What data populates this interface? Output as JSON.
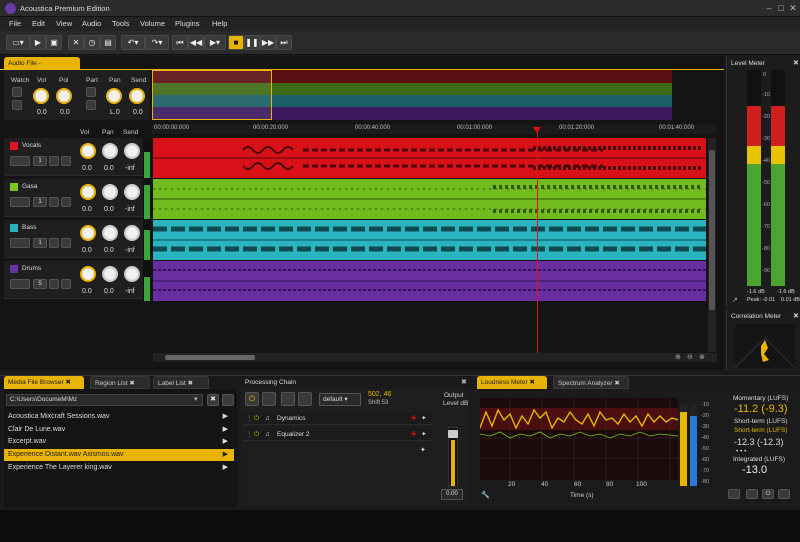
{
  "app": {
    "title": "Acoustica Premium Edition"
  },
  "menu": [
    "File",
    "Edit",
    "View",
    "Audio",
    "Tools",
    "Volume",
    "Plugins",
    "Help"
  ],
  "window_controls": [
    "–",
    "□",
    "✕"
  ],
  "toolbar": {
    "buttons": [
      "new-file-icon",
      "play-icon",
      "save-icon",
      "cut-icon",
      "timer-icon",
      "delete-icon",
      "undo-icon",
      "redo-icon"
    ],
    "transport": [
      "skip-start-icon",
      "rewind-icon",
      "play-icon",
      "stop-icon",
      "pause-icon",
      "fast-forward-icon",
      "skip-end-icon"
    ]
  },
  "editor": {
    "tab_label": "Audio File - Interview.wd",
    "master": {
      "watch_label": "Watch",
      "vol_label": "Vol",
      "pol_label": "Pol",
      "part_label": "Part",
      "pan_label": "Pan",
      "send_label": "Send",
      "vol_value": "0.0",
      "pol_value": "0.0",
      "pan_value": "L.0",
      "send_value": "0.0"
    },
    "track_headers": {
      "vol": "Vol",
      "pan": "Pan",
      "send": "Send"
    },
    "tracks": [
      {
        "name": "Vocals",
        "color": "#e0131a",
        "vol": "0.0",
        "pan": "0.0",
        "send": "-inf",
        "num": "1"
      },
      {
        "name": "Gasa",
        "color": "#7cc620",
        "vol": "0.0",
        "pan": "0.0",
        "send": "-inf",
        "num": "1"
      },
      {
        "name": "Bass",
        "color": "#25b3c2",
        "vol": "0.0",
        "pan": "0.0",
        "send": "-inf",
        "num": "1"
      },
      {
        "name": "Drums",
        "color": "#6b2fa6",
        "vol": "0.0",
        "pan": "0.0",
        "send": "-inf",
        "num": "5"
      }
    ],
    "timeline": [
      "00:00:00:000",
      "00:00:20:000",
      "00:00:40:000",
      "00:01:00:000",
      "00:01:20:000",
      "00:01:40:000"
    ]
  },
  "level_meter": {
    "title": "Level Meter",
    "scale": [
      "0",
      "-10",
      "-20",
      "-30",
      "-40",
      "-50",
      "-60",
      "-70",
      "-80",
      "-90"
    ],
    "left_db": "-1.6 dB",
    "right_db": "-1.6 dB",
    "peak_label": "Peak: -0.01",
    "peak_right": "0.01 dB"
  },
  "correlation": {
    "title": "Correlation Meter"
  },
  "browser": {
    "tabs": [
      "Media File Browser",
      "Region List",
      "Label List"
    ],
    "path": "C:\\Users\\DocumeM\\Mz",
    "files": [
      "Acoustica Mixcraft Sessions.wav",
      "Clair De Lune.wav",
      "Excerpt.wav",
      "Experience  Distant.wav  Axismos.wav",
      "Experience  The Layerer king.wav"
    ],
    "selected_index": 3
  },
  "chain": {
    "title": "Processing Chain",
    "preset": "default",
    "readout_top": "502, 46",
    "readout_bottom": "Shift 53",
    "output_label": "Output",
    "level_label": "Level dB",
    "fader_value": "0.00",
    "effects": [
      "Dynamics",
      "Equalizer 2"
    ]
  },
  "loudness": {
    "tabs": [
      "Loudness Meter",
      "Spectrum Analyzer"
    ],
    "x_ticks": [
      "20",
      "40",
      "60",
      "80",
      "100"
    ],
    "axis_label": "Time (s)",
    "right_scale": [
      "-10",
      "-20",
      "-30",
      "-40",
      "-50",
      "-60",
      "-70",
      "-80"
    ],
    "momentary_label": "Momentary (LUFS)",
    "momentary_value": "-11.2 (-9.3)",
    "shortterm_label": "Short-term (LUFS)",
    "shortterm_value": "Short-term (LUFS)",
    "range_value": "-12.3 (-12.3)",
    "integrated_label": "Integrated (LUFS)",
    "integrated_value": "-13.0",
    "dots": "• • •"
  }
}
